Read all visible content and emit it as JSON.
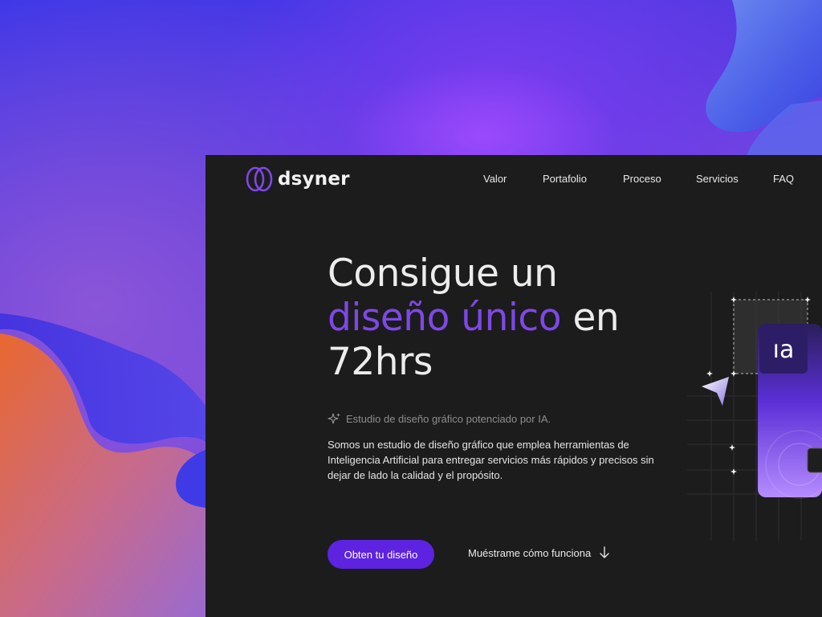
{
  "brand": {
    "name": "dsyner"
  },
  "nav": {
    "items": [
      {
        "label": "Valor"
      },
      {
        "label": "Portafolio"
      },
      {
        "label": "Proceso"
      },
      {
        "label": "Servicios"
      },
      {
        "label": "FAQ"
      }
    ]
  },
  "hero": {
    "title_line1": "Consigue un",
    "title_accent": "diseño único",
    "title_after_accent": " en",
    "title_line3": "72hrs",
    "tagline": "Estudio de diseño gráfico potenciado por IA.",
    "description": "Somos un estudio de diseño gráfico que emplea herramientas de Inteligencia Artificial para entregar servicios más rápidos y precisos sin dejar de lado la calidad y el propósito.",
    "cta_primary": "Obten tu diseño",
    "cta_secondary": "Muéstrame cómo funciona"
  },
  "illustration": {
    "badge_text": "ıa"
  },
  "colors": {
    "accent": "#7e48e6",
    "button": "#5d23e0",
    "window_bg": "#1c1c1c",
    "text": "#ececec",
    "muted_text": "#8d8d8d"
  },
  "icons": [
    "logo-mark-icon",
    "sparkle-icon",
    "arrow-down-icon",
    "cursor-arrow-icon"
  ]
}
